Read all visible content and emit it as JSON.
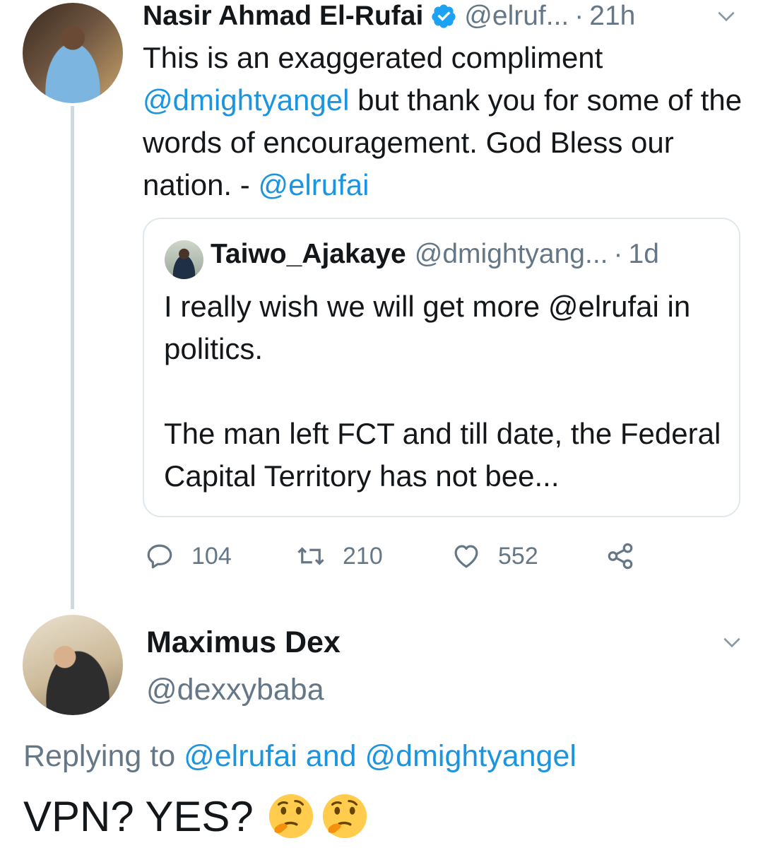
{
  "tweet1": {
    "name": "Nasir Ahmad El-Rufai",
    "handle": "@elruf...",
    "dot": "·",
    "time": "21h",
    "text_1": "This is an exaggerated compliment ",
    "mention_1": "@dmightyangel",
    "text_2": " but thank you for some of the words of encouragement. God Bless our nation. - ",
    "mention_2": "@elrufai",
    "avatar_icon": "avatar-elrufai",
    "verified_icon": "verified-badge-icon"
  },
  "quote": {
    "name": "Taiwo_Ajakaye",
    "handle": "@dmightyang...",
    "dot": "·",
    "time": "1d",
    "line_1": "I really wish we will get more @elrufai in politics.",
    "line_2": "The man left FCT and till date, the Federal Capital Territory has not bee..."
  },
  "actions": {
    "reply_count": "104",
    "retweet_count": "210",
    "like_count": "552"
  },
  "tweet2": {
    "name": "Maximus Dex",
    "handle": "@dexxybaba",
    "replying_prefix": "Replying to ",
    "reply_mention_1": "@elrufai",
    "reply_and": " and ",
    "reply_mention_2": "@dmightyangel",
    "text": "VPN? YES?",
    "emojis": [
      "thinking-face-emoji",
      "thinking-face-emoji"
    ]
  },
  "colors": {
    "link": "#1b95e0",
    "muted": "#657786",
    "text": "#14171a",
    "border": "#e1e8ed",
    "thread_line": "#cfd9de"
  }
}
